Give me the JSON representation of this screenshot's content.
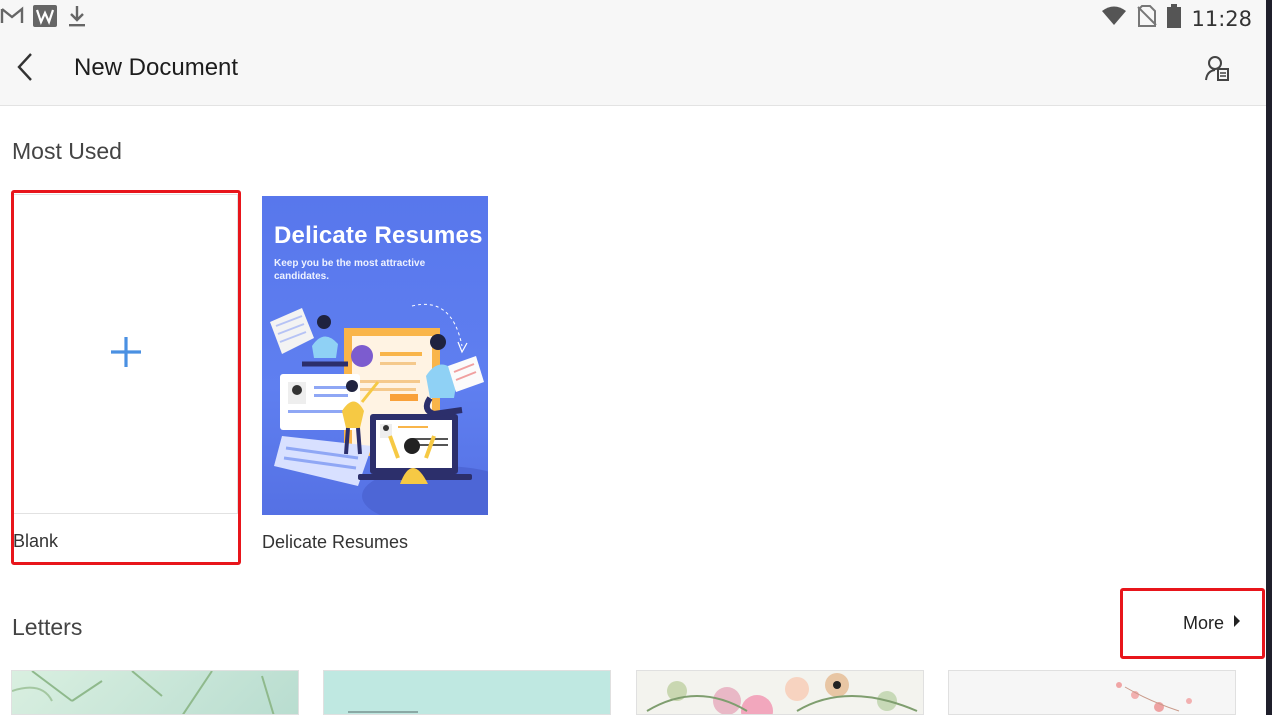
{
  "status_bar": {
    "time": "11:28",
    "left_icons": [
      "gmail-icon",
      "wps-office-icon",
      "download-icon"
    ],
    "right_icons": [
      "wifi-icon",
      "no-sim-icon",
      "battery-icon"
    ]
  },
  "app_bar": {
    "title": "New Document"
  },
  "most_used": {
    "heading": "Most Used",
    "templates": [
      {
        "label": "Blank"
      },
      {
        "label": "Delicate Resumes",
        "thumb_title": "Delicate Resumes",
        "thumb_subtitle": "Keep you be the most attractive candidates."
      }
    ]
  },
  "letters": {
    "heading": "Letters",
    "more_label": "More",
    "thumbnails": [
      "letter-template-1",
      "letter-template-2",
      "letter-template-3",
      "letter-template-4"
    ]
  },
  "colors": {
    "accent": "#4a90e2",
    "highlight": "#e8151b",
    "resume_bg": "#5877ec"
  }
}
